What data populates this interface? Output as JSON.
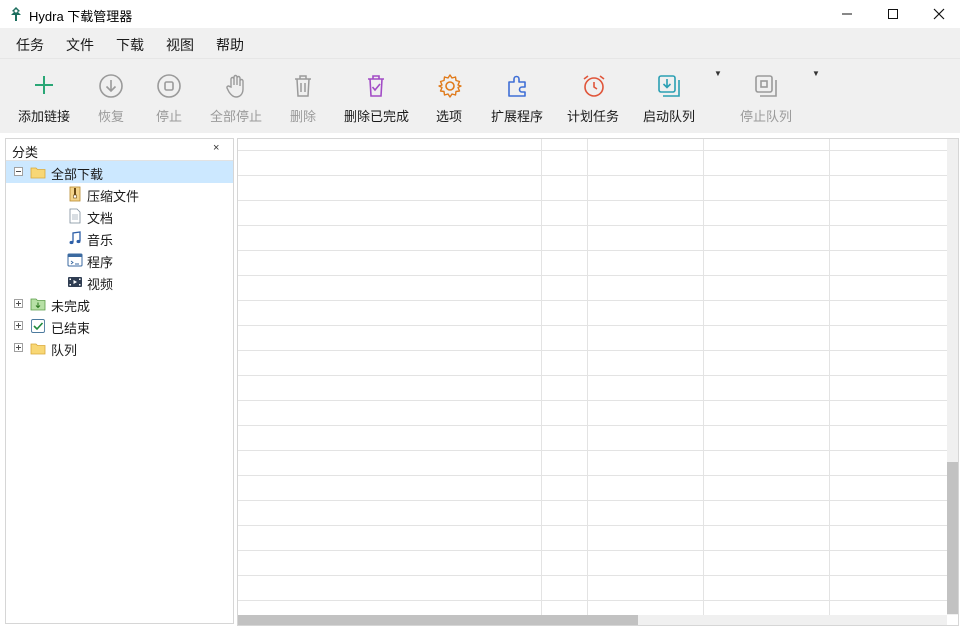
{
  "window": {
    "title": "Hydra 下载管理器"
  },
  "menu": [
    {
      "label": "任务"
    },
    {
      "label": "文件"
    },
    {
      "label": "下载"
    },
    {
      "label": "视图"
    },
    {
      "label": "帮助"
    }
  ],
  "toolbar": {
    "add_link": "添加链接",
    "resume": "恢复",
    "stop": "停止",
    "stop_all": "全部停止",
    "delete": "删除",
    "delete_completed": "删除已完成",
    "options": "选项",
    "extensions": "扩展程序",
    "scheduler": "计划任务",
    "start_queue": "启动队列",
    "stop_queue": "停止队列"
  },
  "sidebar": {
    "title": "分类",
    "close": "×",
    "tree": [
      {
        "label": "全部下载",
        "icon": "folder-open-icon"
      },
      {
        "label": "压缩文件",
        "icon": "archive-icon"
      },
      {
        "label": "文档",
        "icon": "document-icon"
      },
      {
        "label": "音乐",
        "icon": "music-icon"
      },
      {
        "label": "程序",
        "icon": "program-icon"
      },
      {
        "label": "视频",
        "icon": "video-icon"
      },
      {
        "label": "未完成",
        "icon": "download-folder-icon"
      },
      {
        "label": "已结束",
        "icon": "check-icon"
      },
      {
        "label": "队列",
        "icon": "queue-folder-icon"
      }
    ]
  },
  "colors": {
    "accent_green": "#2aa776",
    "selection": "#cce8ff",
    "disabled": "#9a9a9a"
  }
}
